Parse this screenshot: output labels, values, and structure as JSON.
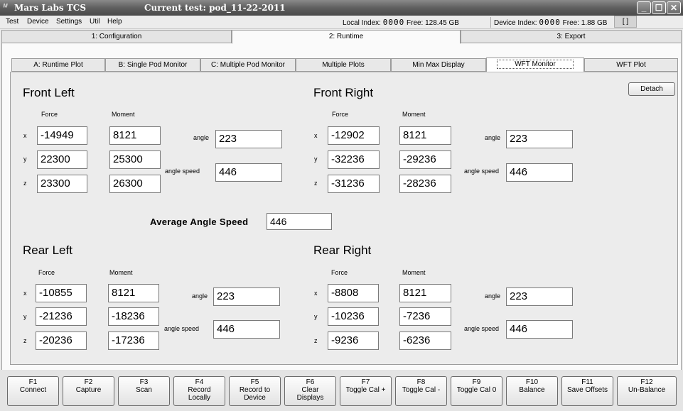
{
  "window": {
    "app_title": "Mars Labs TCS",
    "current_test": "Current test: pod_11-22-2011",
    "controls": {
      "minimize": "_",
      "maximize": "☐",
      "close": "✕"
    }
  },
  "menu": {
    "items": [
      "Test",
      "Device",
      "Settings",
      "Util",
      "Help"
    ],
    "local_index_label": "Local Index:",
    "local_index_value": "0000",
    "local_free": "Free: 128.45 GB",
    "device_index_label": "Device Index:",
    "device_index_value": "0000",
    "device_free": "Free: 1.88 GB",
    "status_box": "[ ]"
  },
  "main_tabs": [
    "1: Configuration",
    "2: Runtime",
    "3: Export"
  ],
  "sub_tabs": [
    "A: Runtime Plot",
    "B: Single Pod Monitor",
    "C: Multiple Pod Monitor",
    "Multiple Plots",
    "Min Max Display",
    "WFT Monitor",
    "WFT Plot"
  ],
  "detach_label": "Detach",
  "labels": {
    "force": "Force",
    "moment": "Moment",
    "x": "x",
    "y": "y",
    "z": "z",
    "angle": "angle",
    "angle_speed": "angle speed"
  },
  "groups": {
    "front_left": {
      "title": "Front Left",
      "force": [
        "-14949",
        "22300",
        "23300"
      ],
      "moment": [
        "8121",
        "25300",
        "26300"
      ],
      "angle": "223",
      "angle_speed": "446"
    },
    "front_right": {
      "title": "Front Right",
      "force": [
        "-12902",
        "-32236",
        "-31236"
      ],
      "moment": [
        "8121",
        "-29236",
        "-28236"
      ],
      "angle": "223",
      "angle_speed": "446"
    },
    "rear_left": {
      "title": "Rear Left",
      "force": [
        "-10855",
        "-21236",
        "-20236"
      ],
      "moment": [
        "8121",
        "-18236",
        "-17236"
      ],
      "angle": "223",
      "angle_speed": "446"
    },
    "rear_right": {
      "title": "Rear Right",
      "force": [
        "-8808",
        "-10236",
        "-9236"
      ],
      "moment": [
        "8121",
        "-7236",
        "-6236"
      ],
      "angle": "223",
      "angle_speed": "446"
    }
  },
  "average": {
    "label": "Average Angle Speed",
    "value": "446"
  },
  "fkeys": [
    {
      "key": "F1",
      "label": "Connect"
    },
    {
      "key": "F2",
      "label": "Capture"
    },
    {
      "key": "F3",
      "label": "Scan"
    },
    {
      "key": "F4",
      "label": "Record\nLocally"
    },
    {
      "key": "F5",
      "label": "Record to\nDevice"
    },
    {
      "key": "F6",
      "label": "Clear\nDisplays"
    },
    {
      "key": "F7",
      "label": "Toggle Cal +"
    },
    {
      "key": "F8",
      "label": "Toggle Cal -"
    },
    {
      "key": "F9",
      "label": "Toggle Cal 0"
    },
    {
      "key": "F10",
      "label": "Balance"
    },
    {
      "key": "F11",
      "label": "Save Offsets"
    },
    {
      "key": "F12",
      "label": "Un-Balance"
    }
  ]
}
